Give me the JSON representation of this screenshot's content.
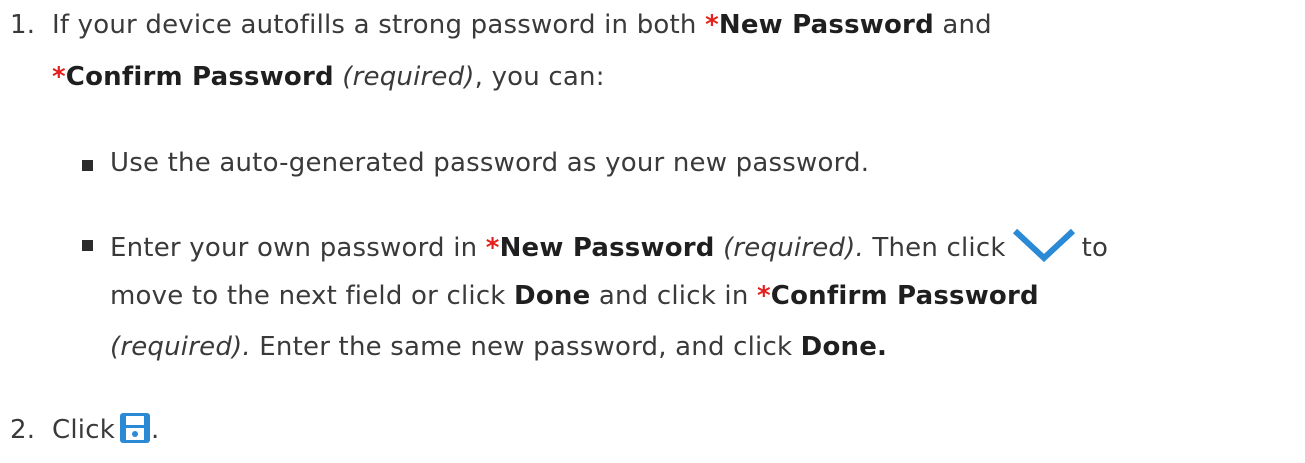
{
  "step1": {
    "number": "1.",
    "line1_pre": "If your device autofills a strong password in both ",
    "asterisk": "*",
    "new_password": "New Password",
    "line1_post": " and",
    "confirm_password": "Confirm Password",
    "required": "(required)",
    "line2_post": ", you can:"
  },
  "bullet1": {
    "text": "Use the auto-generated password as your new password."
  },
  "bullet2": {
    "l1_pre": "Enter your own password in ",
    "l1_required": "(required).",
    "l1_then": " Then click",
    "l1_to": "to",
    "l2_pre": "move to the next field or click ",
    "done": "Done",
    "l2_mid": " and click in ",
    "l3_required": "(required).",
    "l3_post": " Enter the same new password, and click ",
    "done_end": "Done."
  },
  "step2": {
    "number": "2.",
    "click": "Click",
    "period": "."
  },
  "icons": {
    "chevron": "chevron-down-icon",
    "save": "save-icon"
  },
  "colors": {
    "required_asterisk": "#e3211c",
    "icon_blue": "#2a8ad6"
  }
}
